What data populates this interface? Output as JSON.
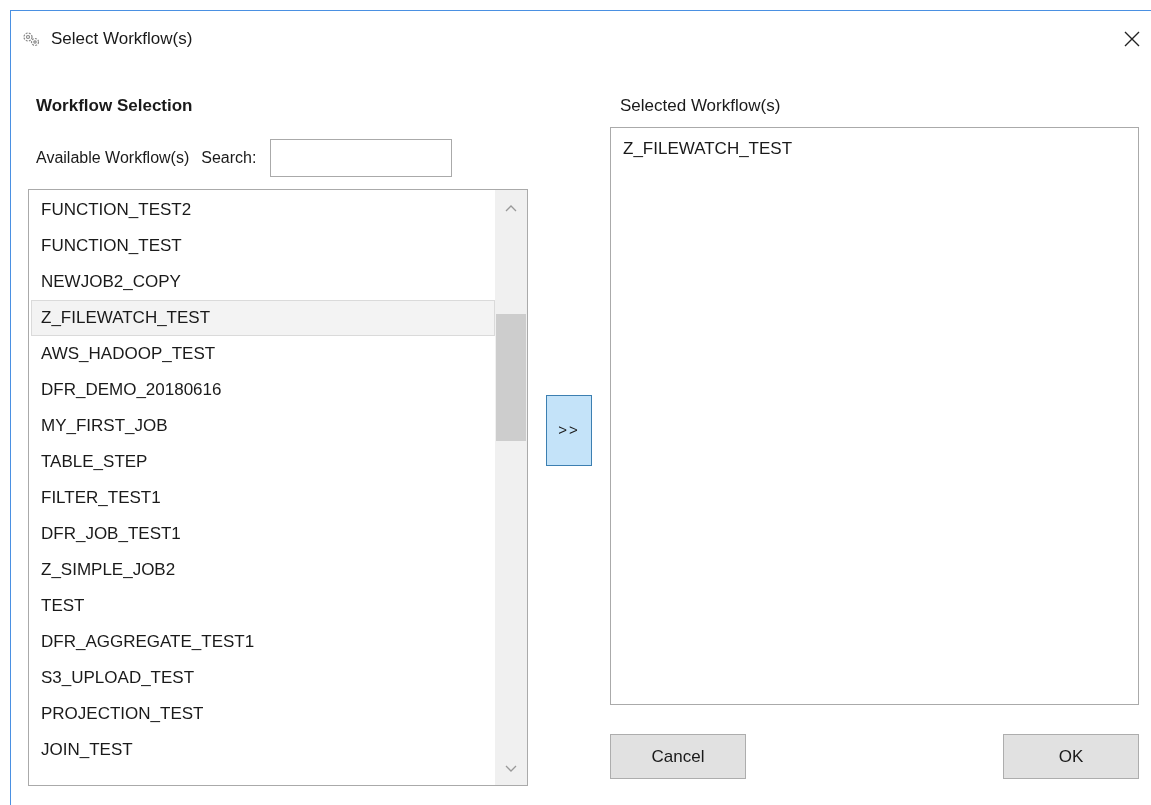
{
  "window": {
    "title": "Select Workflow(s)"
  },
  "heading": "Workflow Selection",
  "available_label": "Available Workflow(s)",
  "search": {
    "label": "Search:"
  },
  "available": [
    {
      "name": "FUNCTION_TEST2",
      "selected": false
    },
    {
      "name": "FUNCTION_TEST",
      "selected": false
    },
    {
      "name": "NEWJOB2_COPY",
      "selected": false
    },
    {
      "name": "Z_FILEWATCH_TEST",
      "selected": true
    },
    {
      "name": "AWS_HADOOP_TEST",
      "selected": false
    },
    {
      "name": "DFR_DEMO_20180616",
      "selected": false
    },
    {
      "name": "MY_FIRST_JOB",
      "selected": false
    },
    {
      "name": "TABLE_STEP",
      "selected": false
    },
    {
      "name": "FILTER_TEST1",
      "selected": false
    },
    {
      "name": "DFR_JOB_TEST1",
      "selected": false
    },
    {
      "name": "Z_SIMPLE_JOB2",
      "selected": false
    },
    {
      "name": "TEST",
      "selected": false
    },
    {
      "name": "DFR_AGGREGATE_TEST1",
      "selected": false
    },
    {
      "name": "S3_UPLOAD_TEST",
      "selected": false
    },
    {
      "name": "PROJECTION_TEST",
      "selected": false
    },
    {
      "name": "JOIN_TEST",
      "selected": false
    }
  ],
  "add_button": ">>",
  "selected_label": "Selected Workflow(s)",
  "selected": [
    "Z_FILEWATCH_TEST"
  ],
  "buttons": [
    "Cancel",
    "OK"
  ]
}
